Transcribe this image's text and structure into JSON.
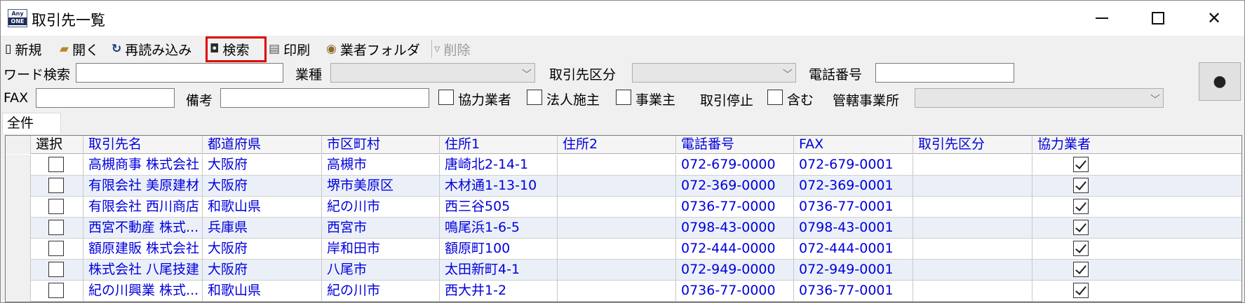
{
  "window": {
    "title": "取引先一覧",
    "app_icon_top": "Any",
    "app_icon_bottom": "ONE"
  },
  "toolbar": {
    "new": "新規",
    "open": "開く",
    "reload": "再読み込み",
    "search": "検索",
    "print": "印刷",
    "vendor_folder": "業者フォルダ",
    "delete": "削除"
  },
  "filters": {
    "word_search": "ワード検索",
    "industry": "業種",
    "partner_category": "取引先区分",
    "phone": "電話番号",
    "fax": "FAX",
    "remarks": "備考",
    "cooperative": "協力業者",
    "corporate_client": "法人施主",
    "business_owner": "事業主",
    "suspended": "取引停止",
    "include": "含む",
    "office": "管轄事業所"
  },
  "tab": {
    "label": "全件"
  },
  "grid": {
    "columns": [
      "選択",
      "取引先名",
      "都道府県",
      "市区町村",
      "住所1",
      "住所2",
      "電話番号",
      "FAX",
      "取引先区分",
      "協力業者"
    ],
    "rows": [
      {
        "name": "高槻商事 株式会社",
        "pref": "大阪府",
        "city": "高槻市",
        "addr1": "唐崎北2-14-1",
        "addr2": "",
        "tel": "072-679-0000",
        "fax": "072-679-0001",
        "category": "",
        "selected": false,
        "coop": true
      },
      {
        "name": "有限会社 美原建材",
        "pref": "大阪府",
        "city": "堺市美原区",
        "addr1": "木材通1-13-10",
        "addr2": "",
        "tel": "072-369-0000",
        "fax": "072-369-0001",
        "category": "",
        "selected": false,
        "coop": true
      },
      {
        "name": "有限会社 西川商店",
        "pref": "和歌山県",
        "city": "紀の川市",
        "addr1": "西三谷505",
        "addr2": "",
        "tel": "0736-77-0000",
        "fax": "0736-77-0001",
        "category": "",
        "selected": false,
        "coop": true
      },
      {
        "name": "西宮不動産 株式...",
        "pref": "兵庫県",
        "city": "西宮市",
        "addr1": "鳴尾浜1-6-5",
        "addr2": "",
        "tel": "0798-43-0000",
        "fax": "0798-43-0001",
        "category": "",
        "selected": false,
        "coop": true
      },
      {
        "name": "額原建販 株式会社",
        "pref": "大阪府",
        "city": "岸和田市",
        "addr1": "額原町100",
        "addr2": "",
        "tel": "072-444-0000",
        "fax": "072-444-0001",
        "category": "",
        "selected": false,
        "coop": true
      },
      {
        "name": "株式会社 八尾技建",
        "pref": "大阪府",
        "city": "八尾市",
        "addr1": "太田新町4-1",
        "addr2": "",
        "tel": "072-949-0000",
        "fax": "072-949-0001",
        "category": "",
        "selected": false,
        "coop": true
      },
      {
        "name": "紀の川興業 株式...",
        "pref": "和歌山県",
        "city": "紀の川市",
        "addr1": "西大井1-2",
        "addr2": "",
        "tel": "0736-77-0000",
        "fax": "0736-77-0001",
        "category": "",
        "selected": false,
        "coop": true
      }
    ]
  }
}
